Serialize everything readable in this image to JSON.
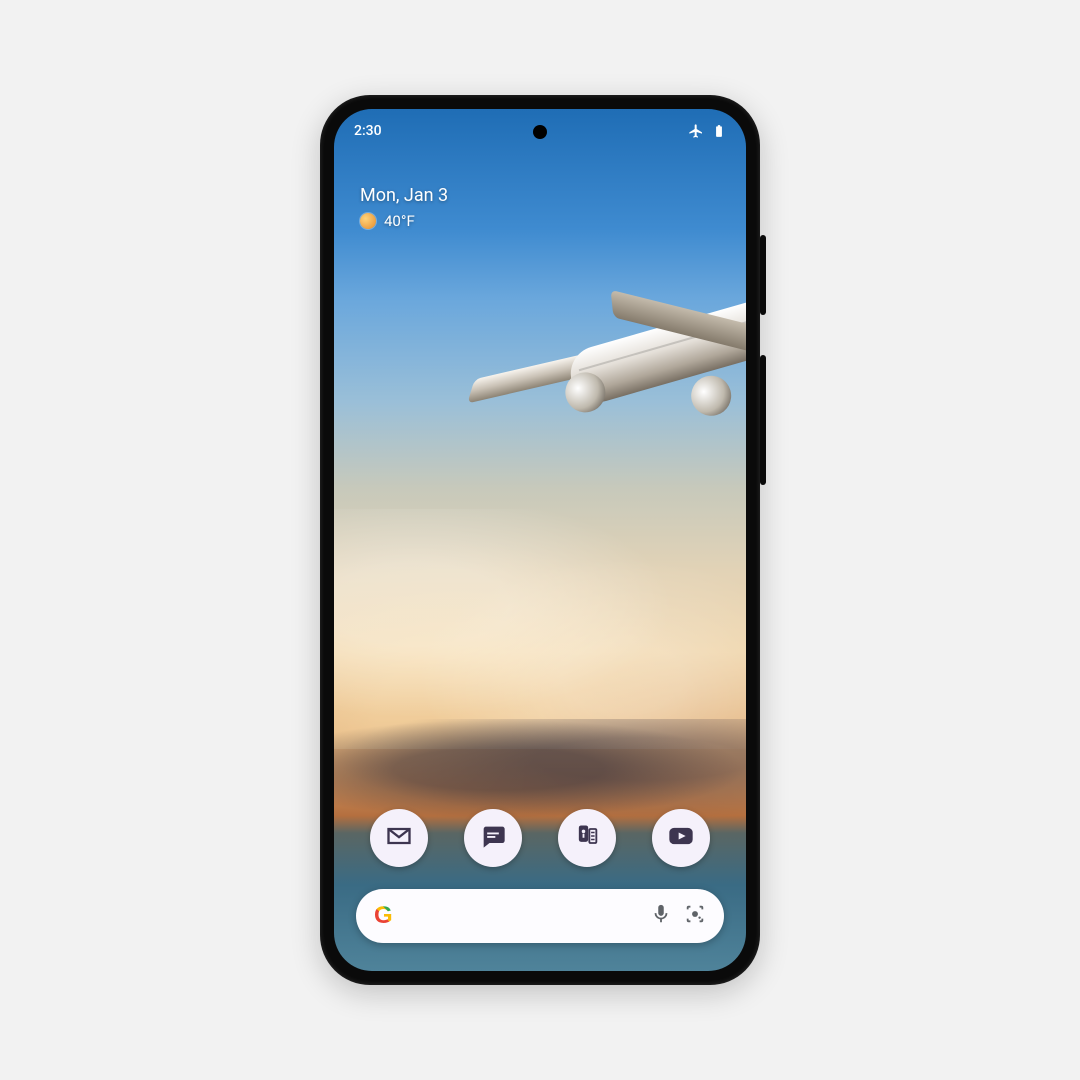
{
  "status_bar": {
    "time": "2:30",
    "airplane_mode_icon": "airplane-mode-icon",
    "battery_icon": "battery-full-icon"
  },
  "at_a_glance": {
    "date": "Mon, Jan 3",
    "temperature": "40°F",
    "weather_icon": "sunny-icon"
  },
  "dock": {
    "apps": [
      {
        "name": "gmail-app",
        "label": "Gmail"
      },
      {
        "name": "messages-app",
        "label": "Messages"
      },
      {
        "name": "recorder-app",
        "label": "Recorder"
      },
      {
        "name": "youtube-app",
        "label": "YouTube"
      }
    ]
  },
  "search": {
    "logo": "G",
    "mic_icon": "mic-icon",
    "lens_icon": "lens-icon"
  },
  "colors": {
    "dock_icon_fg": "#3d3550",
    "dock_bg": "#f5f1fb",
    "search_bg": "#fdfcff"
  }
}
